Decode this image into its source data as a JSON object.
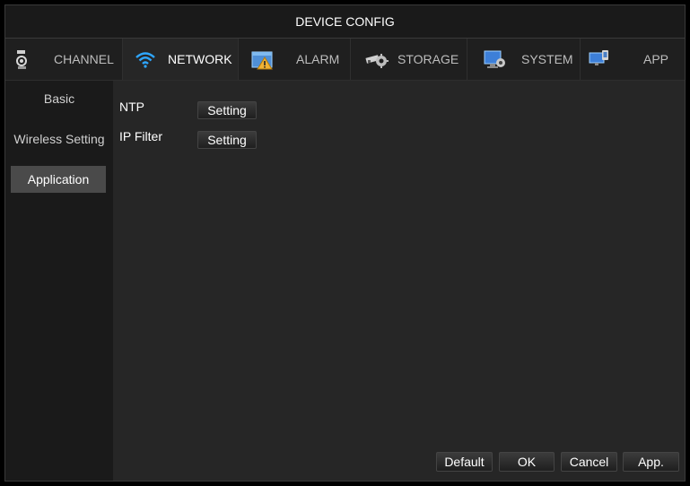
{
  "window": {
    "title": "DEVICE CONFIG"
  },
  "tabs": [
    {
      "label": "CHANNEL",
      "icon": "channel-icon",
      "active": false
    },
    {
      "label": "NETWORK",
      "icon": "wifi-icon",
      "active": true
    },
    {
      "label": "ALARM",
      "icon": "alarm-icon",
      "active": false
    },
    {
      "label": "STORAGE",
      "icon": "storage-icon",
      "active": false
    },
    {
      "label": "SYSTEM",
      "icon": "system-icon",
      "active": false
    },
    {
      "label": "APP",
      "icon": "app-icon",
      "active": false
    }
  ],
  "sidebar": {
    "items": [
      {
        "label": "Basic"
      },
      {
        "label": "Wireless Setting"
      },
      {
        "label": "Application",
        "active": true
      }
    ]
  },
  "content": {
    "rows": [
      {
        "label": "NTP",
        "button": "Setting"
      },
      {
        "label": "IP Filter",
        "button": "Setting"
      }
    ]
  },
  "footer": {
    "default": "Default",
    "ok": "OK",
    "cancel": "Cancel",
    "apply": "App."
  },
  "colors": {
    "background": "#1c1c1c",
    "active_tab": "#262626",
    "active_sidebar": "#4a4a4a",
    "wifi_accent": "#2ea6ff"
  }
}
